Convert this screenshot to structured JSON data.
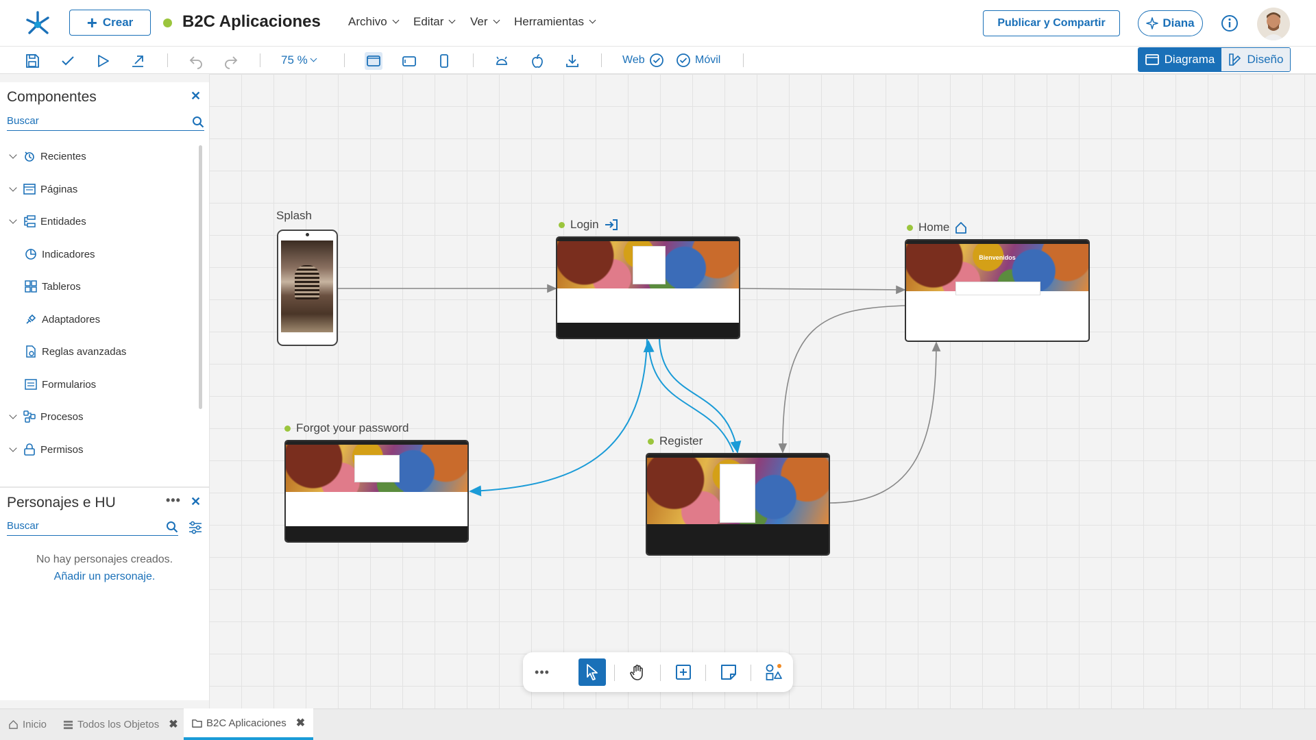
{
  "header": {
    "create_label": "Crear",
    "app_title": "B2C Aplicaciones",
    "menus": [
      "Archivo",
      "Editar",
      "Ver",
      "Herramientas"
    ],
    "publish_label": "Publicar y Compartir",
    "assistant_label": "Diana"
  },
  "toolbar": {
    "zoom": "75 %",
    "platform_web": "Web",
    "platform_mobile": "Móvil",
    "view_diagram": "Diagrama",
    "view_design": "Diseño"
  },
  "components_panel": {
    "title": "Componentes",
    "search_placeholder": "Buscar",
    "items": [
      {
        "label": "Recientes",
        "icon": "recent-icon",
        "expandable": true
      },
      {
        "label": "Páginas",
        "icon": "pages-icon",
        "expandable": true
      },
      {
        "label": "Entidades",
        "icon": "entities-icon",
        "expandable": true
      },
      {
        "label": "Indicadores",
        "icon": "indicators-icon",
        "expandable": false
      },
      {
        "label": "Tableros",
        "icon": "dashboards-icon",
        "expandable": false
      },
      {
        "label": "Adaptadores",
        "icon": "adapters-icon",
        "expandable": false
      },
      {
        "label": "Reglas avanzadas",
        "icon": "rules-icon",
        "expandable": false
      },
      {
        "label": "Formularios",
        "icon": "forms-icon",
        "expandable": false
      },
      {
        "label": "Procesos",
        "icon": "processes-icon",
        "expandable": true
      },
      {
        "label": "Permisos",
        "icon": "permissions-icon",
        "expandable": true
      }
    ]
  },
  "personas_panel": {
    "title": "Personajes e HU",
    "search_placeholder": "Buscar",
    "empty_text": "No hay personajes creados.",
    "add_link": "Añadir un personaje."
  },
  "diagram": {
    "nodes": [
      {
        "id": "splash",
        "label": "Splash",
        "type": "mobile"
      },
      {
        "id": "login",
        "label": "Login",
        "type": "web",
        "badge": "login-icon"
      },
      {
        "id": "home",
        "label": "Home",
        "type": "web",
        "badge": "home-icon"
      },
      {
        "id": "forgot",
        "label": "Forgot your password",
        "type": "web"
      },
      {
        "id": "register",
        "label": "Register",
        "type": "web"
      }
    ],
    "home_banner_text": "Bienvenidos"
  },
  "tabs": [
    {
      "label": "Inicio",
      "icon": "home-icon",
      "closable": false
    },
    {
      "label": "Todos los Objetos",
      "icon": "list-icon",
      "closable": true
    },
    {
      "label": "B2C Aplicaciones",
      "icon": "folder-icon",
      "closable": true,
      "active": true
    }
  ],
  "colors": {
    "primary": "#1a70b8",
    "accent_dot": "#9bc53d",
    "link_arrow": "#1a9bd7",
    "flow_arrow": "#888888"
  }
}
